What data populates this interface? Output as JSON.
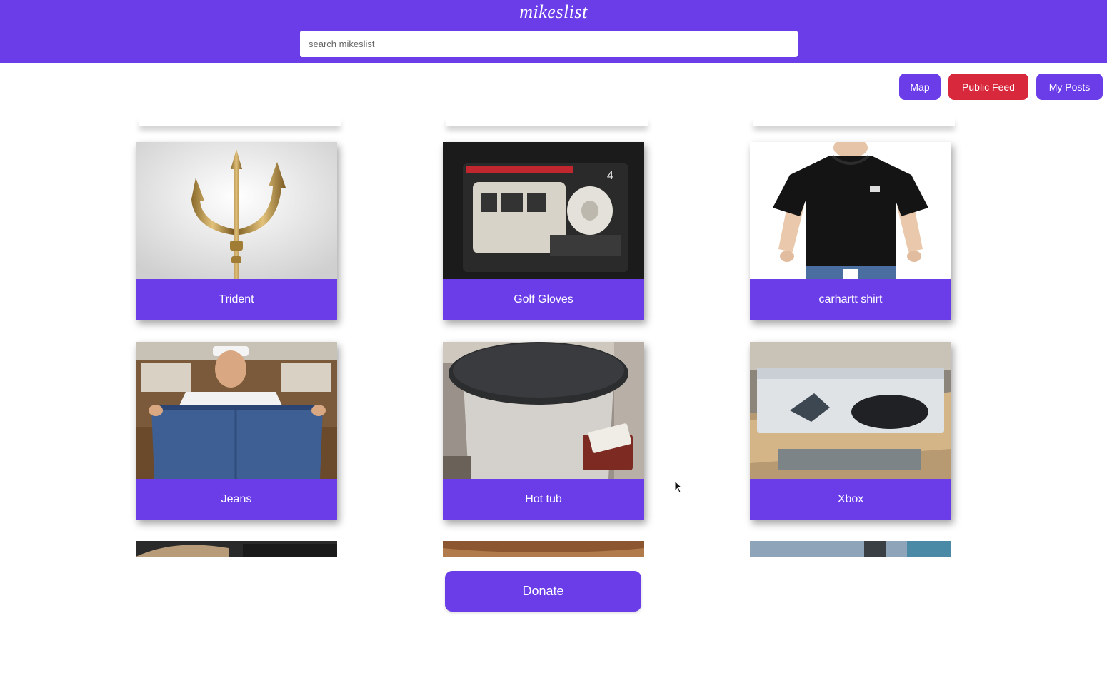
{
  "header": {
    "logo": "mikeslist",
    "search_placeholder": "search mikeslist"
  },
  "nav": {
    "map_label": "Map",
    "public_feed_label": "Public Feed",
    "my_posts_label": "My Posts"
  },
  "listings": [
    {
      "title": "Trident",
      "icon": "trident-photo"
    },
    {
      "title": "Golf Gloves",
      "icon": "golf-gloves-photo"
    },
    {
      "title": "carhartt shirt",
      "icon": "tshirt-photo"
    },
    {
      "title": "Jeans",
      "icon": "jeans-photo"
    },
    {
      "title": "Hot tub",
      "icon": "hot-tub-photo"
    },
    {
      "title": "Xbox",
      "icon": "xbox-photo"
    }
  ],
  "donate_label": "Donate",
  "colors": {
    "brand": "#6a3de8",
    "public_feed": "#d8283b"
  }
}
